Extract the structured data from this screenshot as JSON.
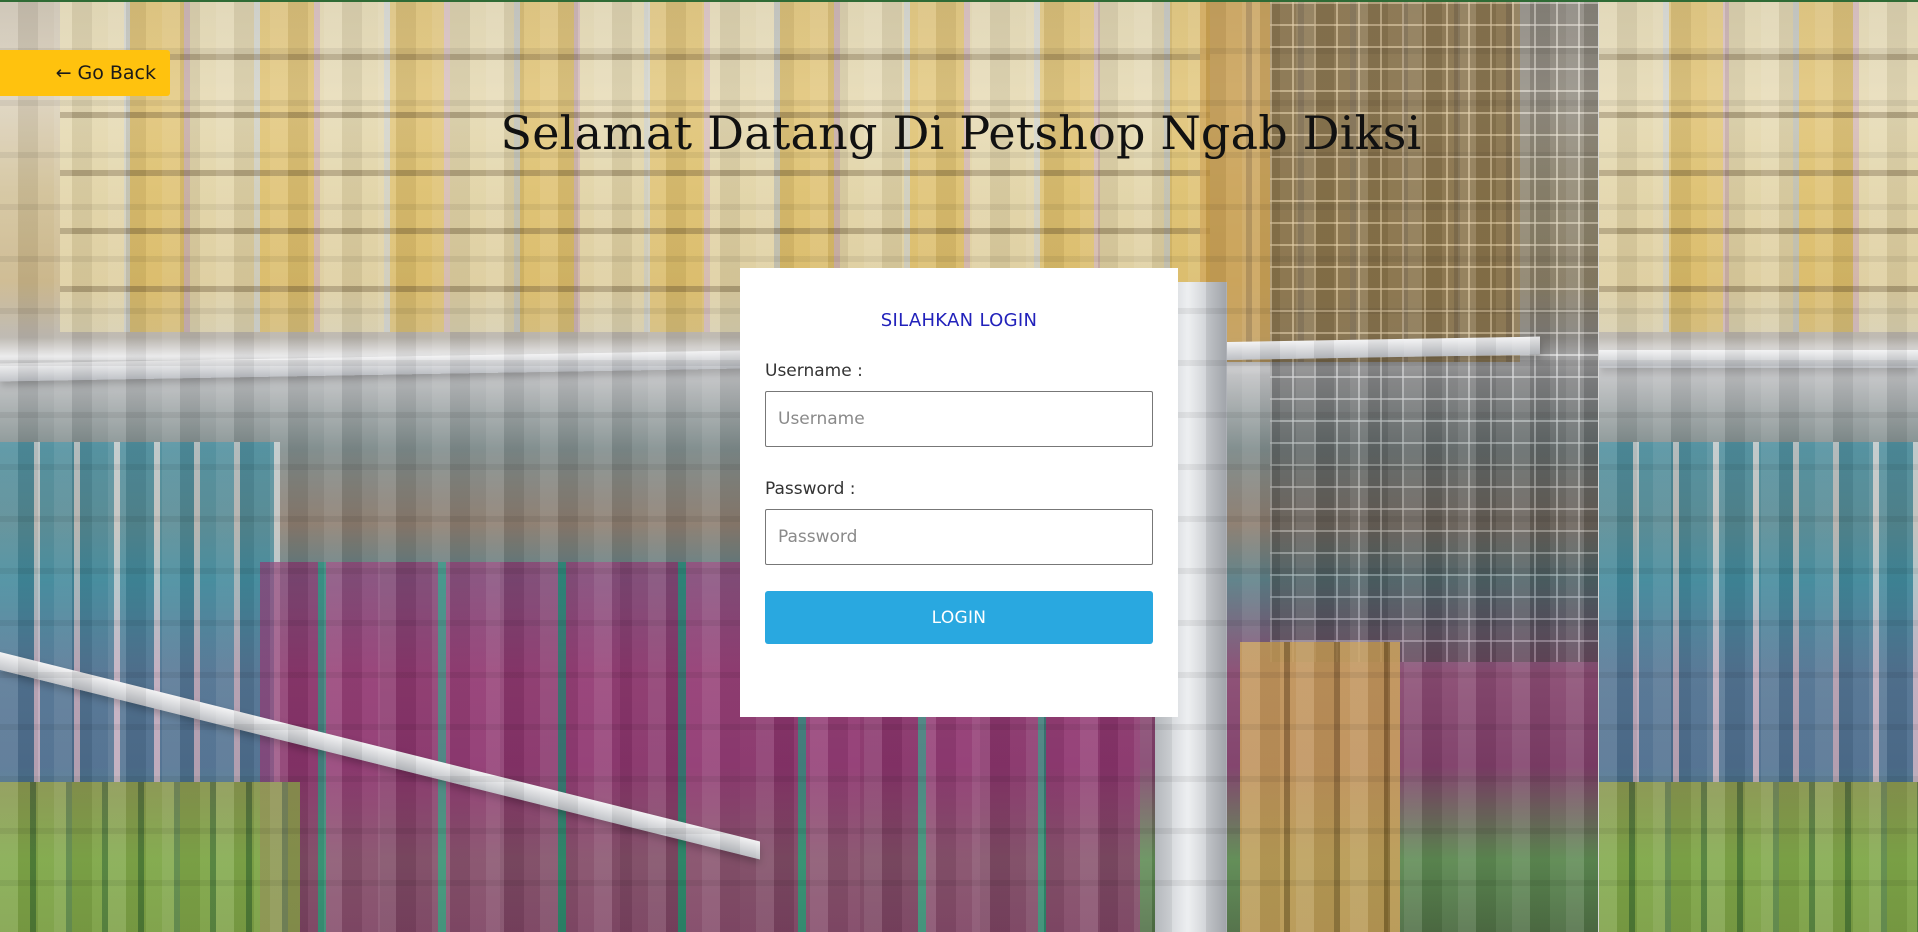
{
  "background": {
    "description_icon": "petshop-shelves-photo",
    "theme_colors": {
      "go_back_bg": "#ffc20e",
      "login_button_bg": "#29a8e0",
      "card_heading_color": "#2222bb",
      "card_bg": "#ffffff"
    }
  },
  "nav": {
    "go_back_arrow": "←",
    "go_back_label": "Go Back"
  },
  "header": {
    "title": "Selamat Datang Di Petshop Ngab Diksi"
  },
  "login": {
    "heading": "SILAHKAN LOGIN",
    "username_label": "Username :",
    "username_placeholder": "Username",
    "username_value": "",
    "password_label": "Password :",
    "password_placeholder": "Password",
    "password_value": "",
    "submit_label": "LOGIN"
  }
}
